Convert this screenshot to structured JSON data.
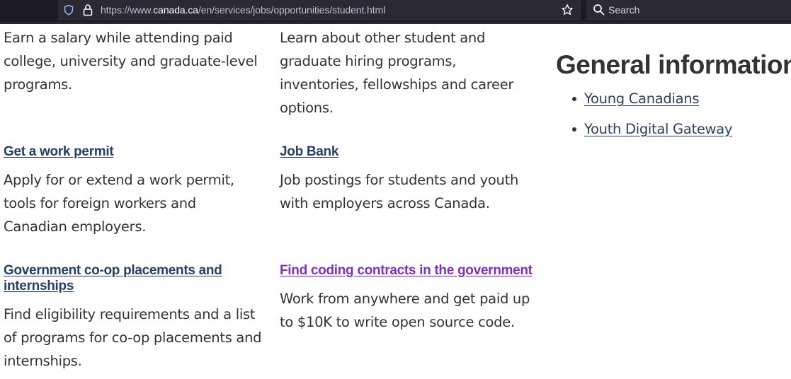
{
  "browser": {
    "url_prefix": "https://www.",
    "url_domain": "canada.ca",
    "url_path": "/en/services/jobs/opportunities/student.html",
    "search_placeholder": "Search",
    "icons": [
      "shield-icon",
      "lock-icon",
      "star-icon",
      "search-icon"
    ]
  },
  "columns": [
    {
      "top_text": "Earn a salary while attending paid college, university and graduate-level programs.",
      "items": [
        {
          "link": "Get a work permit",
          "description": "Apply for or extend a work permit, tools for foreign workers and Canadian employers."
        },
        {
          "link": "Government co-op placements and internships",
          "description": "Find eligibility requirements and a list of programs for co-op placements and internships."
        }
      ]
    },
    {
      "top_text": "Learn about other student and graduate hiring programs, inventories, fellowships and career options.",
      "items": [
        {
          "link": "Job Bank",
          "description": "Job postings for students and youth with employers across Canada."
        },
        {
          "link": "Find coding contracts in the government",
          "description": "Work from anywhere and get paid up to $10K to write open source code."
        }
      ]
    }
  ],
  "general_information": {
    "heading": "General information",
    "links": [
      "Young Canadians",
      "Youth Digital Gateway"
    ]
  },
  "colors": {
    "link": "#284162",
    "visited_link": "#7834bc",
    "text": "#333333",
    "toolbar": "#1c1b22",
    "urlbar": "#2b2a33"
  }
}
